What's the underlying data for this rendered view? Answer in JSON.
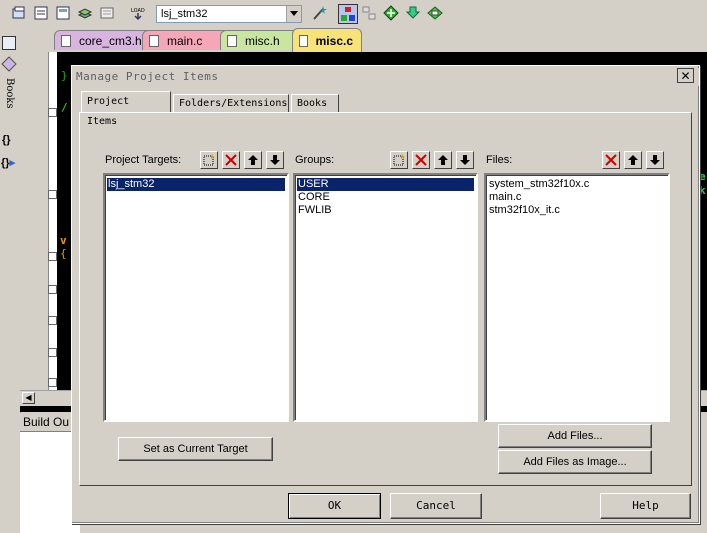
{
  "toolbar": {
    "target_combo": "lsj_stm32",
    "icons": [
      "new-project-icon",
      "batch-build-icon",
      "rebuild-icon",
      "stack-icon",
      "copy-icon",
      "load-icon",
      "wand-icon",
      "target-options-icon",
      "manage-components-icon",
      "debug-icon",
      "pack-icon"
    ]
  },
  "tabs": [
    {
      "label": "core_cm3.h",
      "color": "#d8b4e0"
    },
    {
      "label": "main.c",
      "color": "#f5a7b8"
    },
    {
      "label": "misc.h",
      "color": "#c8e6a0"
    },
    {
      "label": "misc.c",
      "color": "#f7e37a"
    }
  ],
  "left_strip": {
    "label": "Books",
    "braces": "{}"
  },
  "build_output": {
    "label": "Build Ou"
  },
  "dialog": {
    "title": "Manage Project Items",
    "tabs": [
      "Project Items",
      "Folders/Extensions",
      "Books"
    ],
    "targets": {
      "header": "Project Targets:",
      "items": [
        "lsj_stm32"
      ],
      "selected": 0
    },
    "groups": {
      "header": "Groups:",
      "items": [
        "USER",
        "CORE",
        "FWLIB"
      ],
      "selected": 0
    },
    "files": {
      "header": "Files:",
      "items": [
        "system_stm32f10x.c",
        "main.c",
        "stm32f10x_it.c"
      ]
    },
    "buttons": {
      "set_current": "Set as Current Target",
      "add_files": "Add Files...",
      "add_files_image": "Add Files as Image...",
      "ok": "OK",
      "cancel": "Cancel",
      "help": "Help"
    }
  },
  "code_fragments": [
    "}",
    "}",
    "/",
    "v",
    "{",
    "e",
    "k"
  ]
}
